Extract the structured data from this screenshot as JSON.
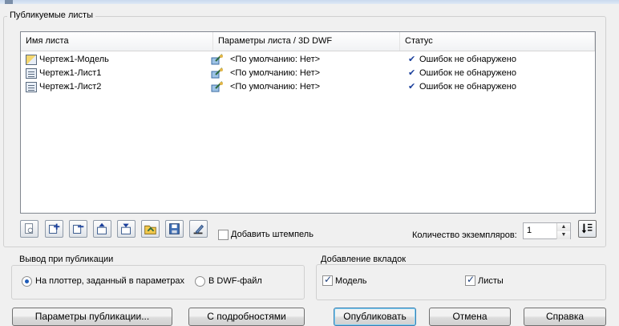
{
  "group_published": {
    "title": "Публикуемые листы"
  },
  "columns": [
    "Имя листа",
    "Параметры листа / 3D DWF",
    "Статус"
  ],
  "rows": [
    {
      "name": "Чертеж1-Модель",
      "settings": "<По умолчанию: Нет>",
      "status": "Ошибок не обнаружено",
      "icon": "model-sheet-icon"
    },
    {
      "name": "Чертеж1-Лист1",
      "settings": "<По умолчанию: Нет>",
      "status": "Ошибок не обнаружено",
      "icon": "layout-sheet-icon"
    },
    {
      "name": "Чертеж1-Лист2",
      "settings": "<По умолчанию: Нет>",
      "status": "Ошибок не обнаружено",
      "icon": "layout-sheet-icon"
    }
  ],
  "toolbar": {
    "icons": [
      "preview-icon",
      "add-sheets-icon",
      "remove-sheets-icon",
      "move-up-icon",
      "move-down-icon",
      "load-list-icon",
      "save-list-icon",
      "stamp-settings-icon"
    ],
    "add_stamp_label": "Добавить штемпель",
    "add_stamp_checked": false,
    "copies_label": "Количество экземпляров:",
    "copies_value": "1"
  },
  "output": {
    "title": "Вывод при публикации",
    "option_plotter": "На плоттер, заданный в параметрах",
    "option_dwf": "В DWF-файл",
    "selected": "plotter"
  },
  "tabs_group": {
    "title": "Добавление вкладок",
    "model_label": "Модель",
    "model_checked": true,
    "sheets_label": "Листы",
    "sheets_checked": true
  },
  "buttons": {
    "publish_options": "Параметры публикации...",
    "details": "С подробностями",
    "publish": "Опубликовать",
    "cancel": "Отмена",
    "help": "Справка"
  },
  "colors": {
    "accent": "#3c7fb1",
    "check": "#1a3f9b"
  }
}
